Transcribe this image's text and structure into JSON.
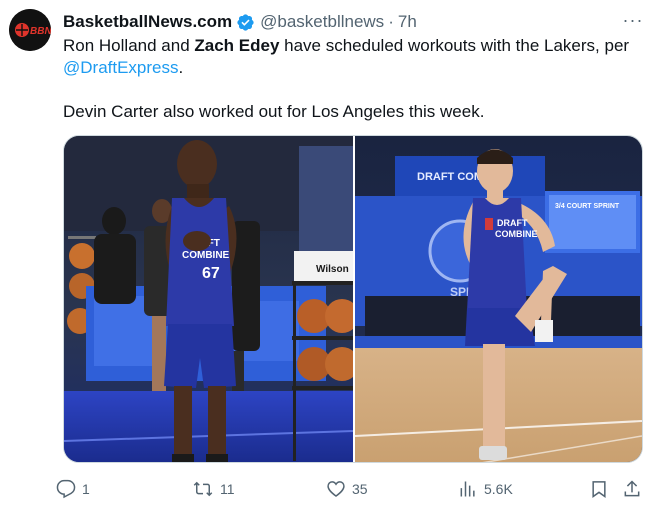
{
  "author": {
    "display_name": "BasketballNews.com",
    "handle": "@basketbllnews",
    "separator": "·",
    "time": "7h",
    "avatar_text": "BBN"
  },
  "tweet": {
    "line1_a": "Ron Holland and ",
    "line1_bold": "Zach Edey",
    "line1_b": " have scheduled workouts with the Lakers, per",
    "mention": "@DraftExpress",
    "line2_end": ".",
    "line3": "Devin Carter also worked out for Los Angeles this week."
  },
  "more_label": "···",
  "photos": {
    "left": {
      "jersey_top": "DRAFT",
      "jersey_mid": "COMBINE",
      "jersey_number": "67",
      "rack_brand": "Wilson"
    },
    "right": {
      "banner": "DRAFT COMBINE",
      "jersey_top": "DRAFT",
      "jersey_mid": "COMBINE",
      "court_sign": "3/4 COURT SPRINT",
      "floor_text": "SPEED"
    }
  },
  "actions": {
    "reply_count": "1",
    "retweet_count": "11",
    "like_count": "35",
    "views_count": "5.6K"
  },
  "colors": {
    "accent": "#1d9bf0",
    "muted": "#536471",
    "text": "#0f1419",
    "jersey": "#2d3aa8"
  }
}
